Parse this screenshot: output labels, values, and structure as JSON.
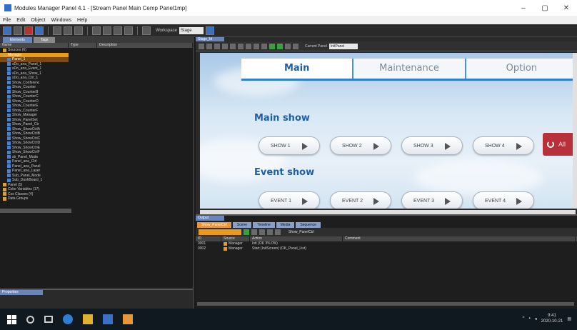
{
  "window": {
    "title": "Modules Manager Panel 4.1 - [Stream Panel Main Cemp Panel1mp]",
    "minimize": "–",
    "maximize": "▢",
    "close": "✕"
  },
  "menu": [
    "File",
    "Edit",
    "Object",
    "Windows",
    "Help"
  ],
  "toolbar": {
    "label": "Workspace",
    "select_value": "Stage"
  },
  "left_panel": {
    "tabs": [
      "Elements",
      "Tags"
    ],
    "columns": [
      "Name",
      "Type",
      "Description"
    ],
    "tree_items": [
      {
        "label": "Sources (6)",
        "kind": "folder",
        "state": "normal"
      },
      {
        "label": "Manager",
        "kind": "folder",
        "state": "sel"
      },
      {
        "label": "Panel_1",
        "kind": "item",
        "state": "hl"
      },
      {
        "label": "sDo_ana_Panel_1",
        "kind": "item",
        "state": "normal"
      },
      {
        "label": "sDo_ana_Event_1",
        "kind": "item",
        "state": "normal"
      },
      {
        "label": "sDo_ana_Show_1",
        "kind": "item",
        "state": "normal"
      },
      {
        "label": "sDo_ana_Ctrl_1",
        "kind": "item",
        "state": "normal"
      },
      {
        "label": "Show_Conferenc",
        "kind": "item",
        "state": "normal"
      },
      {
        "label": "Show_Counter",
        "kind": "item",
        "state": "normal"
      },
      {
        "label": "Show_CounterB",
        "kind": "item",
        "state": "normal"
      },
      {
        "label": "Show_CounterC",
        "kind": "item",
        "state": "normal"
      },
      {
        "label": "Show_CounterD",
        "kind": "item",
        "state": "normal"
      },
      {
        "label": "Show_CounterE",
        "kind": "item",
        "state": "normal"
      },
      {
        "label": "Show_CounterF",
        "kind": "item",
        "state": "normal"
      },
      {
        "label": "Show_Manager",
        "kind": "item",
        "state": "normal"
      },
      {
        "label": "Show_PanelSet",
        "kind": "item",
        "state": "normal"
      },
      {
        "label": "Show_Panel_Ctr",
        "kind": "item",
        "state": "normal"
      },
      {
        "label": "Show_ShowCtrlA",
        "kind": "item",
        "state": "normal"
      },
      {
        "label": "Show_ShowCtrlB",
        "kind": "item",
        "state": "normal"
      },
      {
        "label": "Show_ShowCtrlC",
        "kind": "item",
        "state": "normal"
      },
      {
        "label": "Show_ShowCtrlD",
        "kind": "item",
        "state": "normal"
      },
      {
        "label": "Show_ShowCtrlE",
        "kind": "item",
        "state": "normal"
      },
      {
        "label": "Show_ShowCtrlF",
        "kind": "item",
        "state": "normal"
      },
      {
        "label": "sb_Panel_Mode",
        "kind": "item",
        "state": "normal"
      },
      {
        "label": "Panel_ana_Ctrl",
        "kind": "item",
        "state": "normal"
      },
      {
        "label": "Panel_ana_Panel",
        "kind": "item",
        "state": "normal"
      },
      {
        "label": "Panel_ana_Layer",
        "kind": "item",
        "state": "normal"
      },
      {
        "label": "Sub_Panel_Mode",
        "kind": "item",
        "state": "normal"
      },
      {
        "label": "Sub_DashBoard_1",
        "kind": "item",
        "state": "normal"
      },
      {
        "label": "Panel (5)",
        "kind": "folder",
        "state": "normal"
      },
      {
        "label": "Color Variables (17)",
        "kind": "folder",
        "state": "normal"
      },
      {
        "label": "Css Classes (4)",
        "kind": "folder",
        "state": "normal"
      },
      {
        "label": "Data Groups",
        "kind": "folder",
        "state": "normal"
      }
    ],
    "properties_title": "Properties"
  },
  "design": {
    "tab": "Stage_Id",
    "toolbar_label": "Current Panel",
    "toolbar_select": "InitPanel",
    "screen": {
      "tabs": [
        {
          "label": "Main",
          "active": true
        },
        {
          "label": "Maintenance",
          "active": false
        },
        {
          "label": "Option",
          "active": false
        }
      ],
      "main_show_title": "Main show",
      "event_show_title": "Event show",
      "show_buttons": [
        "SHOW 1",
        "SHOW 2",
        "SHOW 3",
        "SHOW 4"
      ],
      "event_buttons": [
        "EVENT 1",
        "EVENT 2",
        "EVENT 3",
        "EVENT 4"
      ],
      "red_button": "All"
    }
  },
  "output": {
    "title": "Output",
    "tabs": [
      "Show_PanelCtrl",
      "Scene",
      "Timeline",
      "Media",
      "Sequence"
    ],
    "path": "Show_PanelCtrl",
    "columns": [
      "ID",
      "Source",
      "Action",
      "Comment"
    ],
    "rows": [
      {
        "id": "0001",
        "source": "Manager",
        "action": "Init (OK 3% 0%)",
        "comment": ""
      },
      {
        "id": "0002",
        "source": "Manager",
        "action": "Start (InitScreen) (OK_Panel_List)",
        "comment": ""
      }
    ]
  },
  "taskbar": {
    "time": "9:41",
    "date": "2020-10-21"
  },
  "colors": {
    "accent": "#2f7fd0",
    "highlight": "#e89a1e",
    "danger": "#b8303a"
  }
}
